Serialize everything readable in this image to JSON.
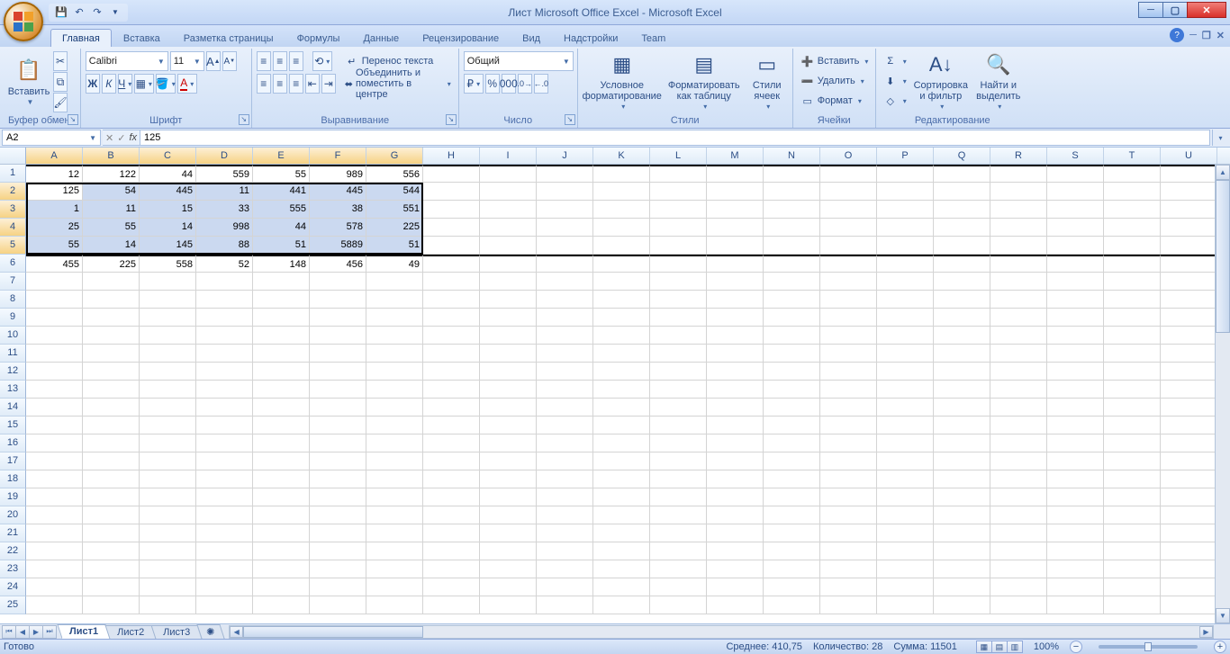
{
  "title": "Лист Microsoft Office Excel - Microsoft Excel",
  "qat": [
    "save",
    "undo",
    "redo",
    "qat-dd"
  ],
  "tabs": [
    "Главная",
    "Вставка",
    "Разметка страницы",
    "Формулы",
    "Данные",
    "Рецензирование",
    "Вид",
    "Надстройки",
    "Team"
  ],
  "active_tab": 0,
  "ribbon": {
    "clipboard": {
      "label": "Буфер обмена",
      "paste": "Вставить"
    },
    "font": {
      "label": "Шрифт",
      "name": "Calibri",
      "size": "11"
    },
    "alignment": {
      "label": "Выравнивание",
      "wrap": "Перенос текста",
      "merge": "Объединить и поместить в центре"
    },
    "number": {
      "label": "Число",
      "format": "Общий"
    },
    "styles": {
      "label": "Стили",
      "cond": "Условное форматирование",
      "table": "Форматировать как таблицу",
      "cell": "Стили ячеек"
    },
    "cells": {
      "label": "Ячейки",
      "insert": "Вставить",
      "delete": "Удалить",
      "format": "Формат"
    },
    "editing": {
      "label": "Редактирование",
      "sort": "Сортировка и фильтр",
      "find": "Найти и выделить"
    }
  },
  "formula_bar": {
    "name_box": "A2",
    "fx": "fx",
    "value": "125"
  },
  "columns": [
    "A",
    "B",
    "C",
    "D",
    "E",
    "F",
    "G",
    "H",
    "I",
    "J",
    "K",
    "L",
    "M",
    "N",
    "O",
    "P",
    "Q",
    "R",
    "S",
    "T",
    "U"
  ],
  "selected_cols": 7,
  "rows": 25,
  "selection": {
    "active_row": 2,
    "sel_rows": [
      2,
      3,
      4,
      5
    ]
  },
  "data": [
    [
      "12",
      "122",
      "44",
      "559",
      "55",
      "989",
      "556"
    ],
    [
      "125",
      "54",
      "445",
      "11",
      "441",
      "445",
      "544"
    ],
    [
      "1",
      "11",
      "15",
      "33",
      "555",
      "38",
      "551"
    ],
    [
      "25",
      "55",
      "14",
      "998",
      "44",
      "578",
      "225"
    ],
    [
      "55",
      "14",
      "145",
      "88",
      "51",
      "5889",
      "51"
    ],
    [
      "455",
      "225",
      "558",
      "52",
      "148",
      "456",
      "49"
    ]
  ],
  "sheets": [
    "Лист1",
    "Лист2",
    "Лист3"
  ],
  "active_sheet": 0,
  "status": {
    "ready": "Готово",
    "avg_label": "Среднее:",
    "avg": "410,75",
    "count_label": "Количество:",
    "count": "28",
    "sum_label": "Сумма:",
    "sum": "11501",
    "zoom": "100%"
  }
}
